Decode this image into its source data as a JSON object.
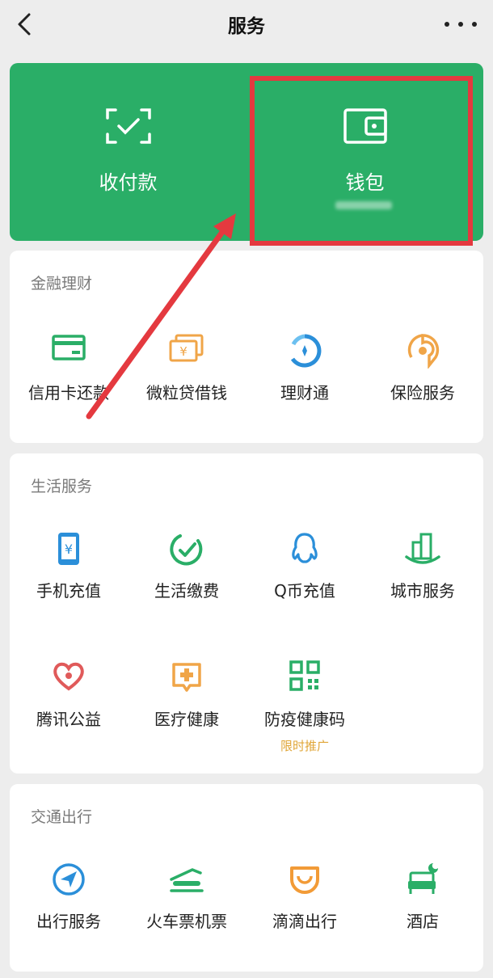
{
  "nav": {
    "title": "服务"
  },
  "hero": {
    "pay_label": "收付款",
    "wallet_label": "钱包"
  },
  "finance": {
    "title": "金融理财",
    "items": [
      {
        "label": "信用卡还款",
        "icon": "credit-card-icon"
      },
      {
        "label": "微粒贷借钱",
        "icon": "loan-icon"
      },
      {
        "label": "理财通",
        "icon": "wealth-icon"
      },
      {
        "label": "保险服务",
        "icon": "insurance-icon"
      }
    ]
  },
  "life": {
    "title": "生活服务",
    "items": [
      {
        "label": "手机充值",
        "icon": "phone-topup-icon"
      },
      {
        "label": "生活缴费",
        "icon": "utility-bill-icon"
      },
      {
        "label": "Q币充值",
        "icon": "qq-coin-icon"
      },
      {
        "label": "城市服务",
        "icon": "city-icon"
      },
      {
        "label": "腾讯公益",
        "icon": "charity-icon"
      },
      {
        "label": "医疗健康",
        "icon": "medical-icon"
      },
      {
        "label": "防疫健康码",
        "icon": "qr-health-code-icon",
        "sub": "限时推广"
      }
    ]
  },
  "transport": {
    "title": "交通出行",
    "items": [
      {
        "label": "出行服务",
        "icon": "navigation-icon"
      },
      {
        "label": "火车票机票",
        "icon": "train-icon"
      },
      {
        "label": "滴滴出行",
        "icon": "didi-icon"
      },
      {
        "label": "酒店",
        "icon": "hotel-icon"
      }
    ]
  },
  "colors": {
    "brand_green": "#2aae67",
    "highlight_red": "#e4393f",
    "promo_orange": "#e0a638"
  }
}
